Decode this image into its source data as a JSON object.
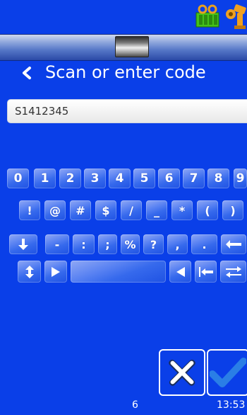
{
  "header": {
    "title": "Scan or enter code"
  },
  "input": {
    "value": "S1412345"
  },
  "keyboard": {
    "row1": [
      "0",
      "1",
      "2",
      "3",
      "4",
      "5",
      "6",
      "7",
      "8",
      "9"
    ],
    "row2": [
      "!",
      "@",
      "#",
      "$",
      "/",
      "_",
      "*",
      "(",
      ")"
    ],
    "row3_labels": [
      "-",
      ":",
      ";",
      "%",
      "?",
      ",",
      "."
    ]
  },
  "footer": {
    "page": "6",
    "time": "13:53"
  },
  "colors": {
    "background": "#0a3fe8",
    "confirm": "#2a7ee6",
    "cancel": "#1b2f5e",
    "battery": "#44c21a",
    "battery_cap": "#e8a020",
    "robot": "#f0a020"
  }
}
